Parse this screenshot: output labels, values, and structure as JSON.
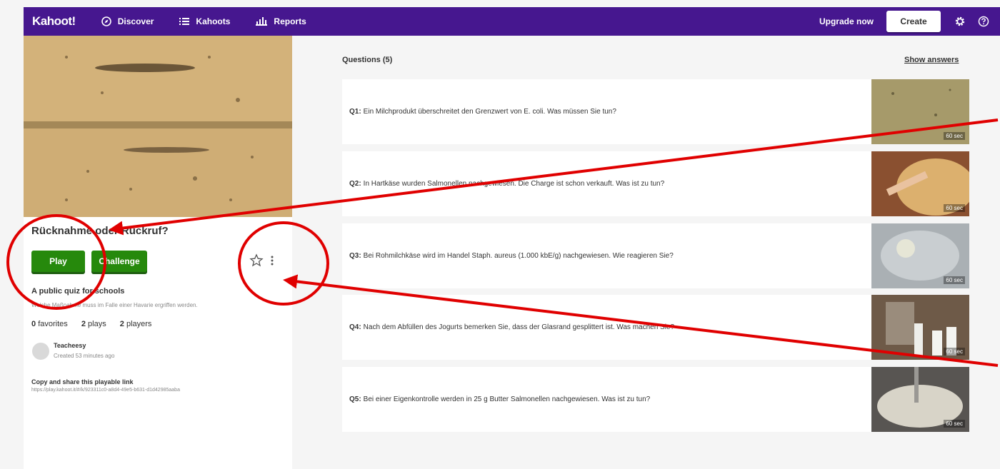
{
  "nav": {
    "logo": "Kahoot!",
    "discover": "Discover",
    "kahoots": "Kahoots",
    "reports": "Reports",
    "upgrade": "Upgrade now",
    "create": "Create",
    "settings_icon": "gear-icon",
    "help_icon": "question-circle-icon",
    "color": "#46178f"
  },
  "kahoot": {
    "title": "Rücknahme oder Rückruf?",
    "play": "Play",
    "challenge": "Challenge",
    "desc_title": "A public quiz for schools",
    "desc": "Welche Maßnahme muss im Falle einer Havarie ergriffen werden.",
    "favorites_count": "0",
    "favorites_label": "favorites",
    "plays_count": "2",
    "plays_label": "plays",
    "players_count": "2",
    "players_label": "players",
    "author": "Teacheesy",
    "created": "Created 53 minutes ago",
    "share_label": "Copy and share this playable link",
    "share_link": "https://play.kahoot.it/#/k/923311c0-a8d4-49e5-b631-d1d42985aaba",
    "button_color": "#26890c"
  },
  "questions": {
    "header": "Questions (5)",
    "show_answers": "Show answers",
    "items": [
      {
        "num": "Q1:",
        "text": "Ein Milchprodukt überschreitet den Grenzwert von E. coli. Was müssen Sie tun?",
        "time": "60 sec"
      },
      {
        "num": "Q2:",
        "text": "In Hartkäse wurden Salmonellen nachgewiesen. Die Charge ist schon verkauft. Was ist zu tun?",
        "time": "60 sec"
      },
      {
        "num": "Q3:",
        "text": "Bei Rohmilchkäse wird im Handel Staph. aureus (1.000 kbE/g) nachgewiesen. Wie reagieren Sie?",
        "time": "60 sec"
      },
      {
        "num": "Q4:",
        "text": "Nach dem Abfüllen des Jogurts bemerken Sie, dass der Glasrand gesplittert ist. Was machen Sie?",
        "time": "60 sec"
      },
      {
        "num": "Q5:",
        "text": "Bei einer Eigenkontrolle werden in 25 g Butter Salmonellen nachgewiesen. Was ist zu tun?",
        "time": "60 sec"
      }
    ]
  },
  "annotation_color": "#e00000"
}
